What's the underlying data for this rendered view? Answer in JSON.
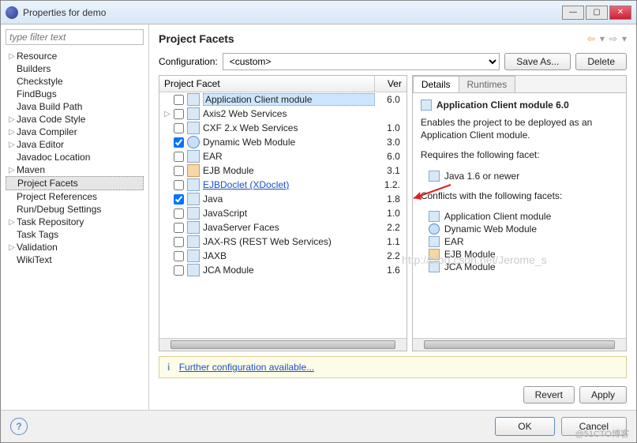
{
  "window": {
    "title": "Properties for demo"
  },
  "filter": {
    "placeholder": "type filter text"
  },
  "nav": [
    {
      "label": "Resource",
      "exp": true
    },
    {
      "label": "Builders"
    },
    {
      "label": "Checkstyle"
    },
    {
      "label": "FindBugs"
    },
    {
      "label": "Java Build Path"
    },
    {
      "label": "Java Code Style",
      "exp": true
    },
    {
      "label": "Java Compiler",
      "exp": true
    },
    {
      "label": "Java Editor",
      "exp": true
    },
    {
      "label": "Javadoc Location"
    },
    {
      "label": "Maven",
      "exp": true
    },
    {
      "label": "Project Facets",
      "sel": true
    },
    {
      "label": "Project References"
    },
    {
      "label": "Run/Debug Settings"
    },
    {
      "label": "Task Repository",
      "exp": true
    },
    {
      "label": "Task Tags"
    },
    {
      "label": "Validation",
      "exp": true
    },
    {
      "label": "WikiText"
    }
  ],
  "main": {
    "heading": "Project Facets",
    "config_label": "Configuration:",
    "config_value": "<custom>",
    "saveas": "Save As...",
    "delete": "Delete",
    "col_facet": "Project Facet",
    "col_ver": "Ver"
  },
  "facets": [
    {
      "name": "Application Client module",
      "ver": "6.0",
      "sel": true,
      "icon": "doc"
    },
    {
      "name": "Axis2 Web Services",
      "ver": "",
      "exp": true,
      "icon": "doc"
    },
    {
      "name": "CXF 2.x Web Services",
      "ver": "1.0",
      "icon": "doc"
    },
    {
      "name": "Dynamic Web Module",
      "ver": "3.0",
      "chk": true,
      "icon": "web"
    },
    {
      "name": "EAR",
      "ver": "6.0",
      "icon": "doc"
    },
    {
      "name": "EJB Module",
      "ver": "3.1",
      "icon": "ejb"
    },
    {
      "name": "EJBDoclet (XDoclet)",
      "ver": "1.2.",
      "link": true,
      "icon": "doc"
    },
    {
      "name": "Java",
      "ver": "1.8",
      "chk": true,
      "icon": "doc"
    },
    {
      "name": "JavaScript",
      "ver": "1.0",
      "icon": "doc"
    },
    {
      "name": "JavaServer Faces",
      "ver": "2.2",
      "icon": "doc"
    },
    {
      "name": "JAX-RS (REST Web Services)",
      "ver": "1.1",
      "icon": "doc"
    },
    {
      "name": "JAXB",
      "ver": "2.2",
      "icon": "doc"
    },
    {
      "name": "JCA Module",
      "ver": "1.6",
      "icon": "doc"
    }
  ],
  "tabs": {
    "details": "Details",
    "runtimes": "Runtimes"
  },
  "details": {
    "title": "Application Client module 6.0",
    "desc": "Enables the project to be deployed as an Application Client module.",
    "requires_h": "Requires the following facet:",
    "requires": [
      {
        "label": "Java 1.6 or newer",
        "icon": "doc"
      }
    ],
    "conflicts_h": "Conflicts with the following facets:",
    "conflicts": [
      {
        "label": "Application Client module",
        "icon": "doc"
      },
      {
        "label": "Dynamic Web Module",
        "icon": "web"
      },
      {
        "label": "EAR",
        "icon": "doc"
      },
      {
        "label": "EJB Module",
        "icon": "ejb"
      },
      {
        "label": "JCA Module",
        "icon": "doc"
      }
    ]
  },
  "info": {
    "prefix": "i",
    "link": "Further configuration available..."
  },
  "buttons": {
    "revert": "Revert",
    "apply": "Apply",
    "ok": "OK",
    "cancel": "Cancel"
  },
  "watermark": "http://blog.csdn.net/Jerome_s",
  "footer_wm": "@51CTO博客"
}
